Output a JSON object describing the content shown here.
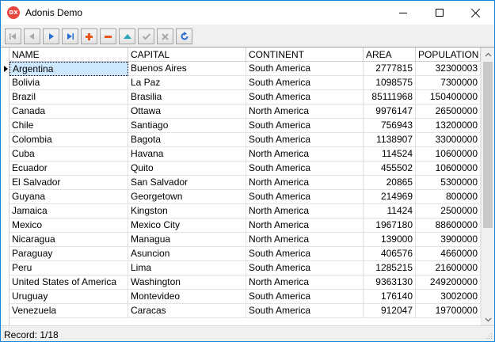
{
  "window": {
    "title": "Adonis Demo",
    "icon_text": "DX",
    "icon_name": "app-logo-icon"
  },
  "toolbar": {
    "buttons": [
      {
        "name": "first-record-button",
        "icon": "skip-first-icon"
      },
      {
        "name": "prior-record-button",
        "icon": "triangle-left-icon"
      },
      {
        "name": "next-record-button",
        "icon": "triangle-right-icon"
      },
      {
        "name": "last-record-button",
        "icon": "skip-last-icon"
      },
      {
        "name": "insert-record-button",
        "icon": "plus-icon"
      },
      {
        "name": "delete-record-button",
        "icon": "minus-icon"
      },
      {
        "name": "edit-record-button",
        "icon": "triangle-up-icon"
      },
      {
        "name": "post-record-button",
        "icon": "checkmark-icon"
      },
      {
        "name": "cancel-record-button",
        "icon": "x-icon"
      },
      {
        "name": "refresh-button",
        "icon": "refresh-icon"
      }
    ],
    "colors": {
      "enabled_blue": "#2b6fd6",
      "insert_orange": "#e8541c",
      "delete_orange": "#e8541c",
      "edit_teal": "#2aa6b7",
      "disabled_gray": "#a8a8a8"
    }
  },
  "grid": {
    "columns": [
      "NAME",
      "CAPITAL",
      "CONTINENT",
      "AREA",
      "POPULATION"
    ],
    "rows": [
      [
        "Argentina",
        "Buenos Aires",
        "South America",
        "2777815",
        "32300003"
      ],
      [
        "Bolivia",
        "La Paz",
        "South America",
        "1098575",
        "7300000"
      ],
      [
        "Brazil",
        "Brasilia",
        "South America",
        "85111968",
        "150400000"
      ],
      [
        "Canada",
        "Ottawa",
        "North America",
        "9976147",
        "26500000"
      ],
      [
        "Chile",
        "Santiago",
        "South America",
        "756943",
        "13200000"
      ],
      [
        "Colombia",
        "Bagota",
        "South America",
        "1138907",
        "33000000"
      ],
      [
        "Cuba",
        "Havana",
        "North America",
        "114524",
        "10600000"
      ],
      [
        "Ecuador",
        "Quito",
        "South America",
        "455502",
        "10600000"
      ],
      [
        "El Salvador",
        "San Salvador",
        "North America",
        "20865",
        "5300000"
      ],
      [
        "Guyana",
        "Georgetown",
        "South America",
        "214969",
        "800000"
      ],
      [
        "Jamaica",
        "Kingston",
        "North America",
        "11424",
        "2500000"
      ],
      [
        "Mexico",
        "Mexico City",
        "North America",
        "1967180",
        "88600000"
      ],
      [
        "Nicaragua",
        "Managua",
        "North America",
        "139000",
        "3900000"
      ],
      [
        "Paraguay",
        "Asuncion",
        "South America",
        "406576",
        "4660000"
      ],
      [
        "Peru",
        "Lima",
        "South America",
        "1285215",
        "21600000"
      ],
      [
        "United States of America",
        "Washington",
        "North America",
        "9363130",
        "249200000"
      ],
      [
        "Uruguay",
        "Montevideo",
        "South America",
        "176140",
        "3002000"
      ],
      [
        "Venezuela",
        "Caracas",
        "South America",
        "912047",
        "19700000"
      ]
    ],
    "selected_row": 0
  },
  "status": {
    "text": "Record: 1/18"
  }
}
